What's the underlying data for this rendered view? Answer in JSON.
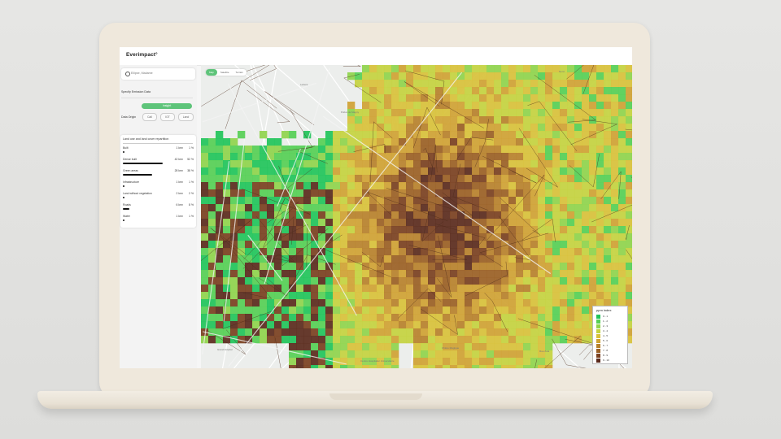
{
  "app": {
    "logo": "Everimpact°"
  },
  "search": {
    "placeholder": "Ellipse, Madame"
  },
  "emission": {
    "title": "Specify Emission Data",
    "insight_label": "Insight"
  },
  "origin": {
    "label": "Data Origin",
    "options": [
      "Call",
      "IOT",
      "Land"
    ]
  },
  "land": {
    "title": "Land use and land cover repartition",
    "rows": [
      {
        "name": "Built",
        "area": "1 km²",
        "pct": "1 %",
        "value": 0.01
      },
      {
        "name": "Dense built",
        "area": "42 km²",
        "pct": "52 %",
        "value": 0.52
      },
      {
        "name": "Green areas",
        "area": "28 km²",
        "pct": "38 %",
        "value": 0.38
      },
      {
        "name": "Infrastructure",
        "area": "1 km²",
        "pct": "1 %",
        "value": 0.01
      },
      {
        "name": "Land without vegetation",
        "area": "2 km²",
        "pct": "2 %",
        "value": 0.02
      },
      {
        "name": "Roads",
        "area": "6 km²",
        "pct": "8 %",
        "value": 0.08
      },
      {
        "name": "Water",
        "area": "1 km²",
        "pct": "1 %",
        "value": 0.01
      }
    ]
  },
  "map": {
    "tabs": [
      "Map",
      "Satellite",
      "Terrain"
    ],
    "labels": [
      "Lettera",
      "Pollux de Magny",
      "Grand Hôpital",
      "Chêne Magique",
      "Centre Hospitalier Universitaire",
      "Rue Zola",
      "Nord"
    ]
  },
  "legend": {
    "title": "ppm index",
    "items": [
      {
        "label": "0 - 1",
        "color": "#21c45a"
      },
      {
        "label": "1 - 2",
        "color": "#56cf55"
      },
      {
        "label": "2 - 3",
        "color": "#8fd44c"
      },
      {
        "label": "3 - 4",
        "color": "#c4d33f"
      },
      {
        "label": "4 - 5",
        "color": "#d8c13a"
      },
      {
        "label": "5 - 6",
        "color": "#cfa233"
      },
      {
        "label": "6 - 7",
        "color": "#b7812b"
      },
      {
        "label": "7 - 8",
        "color": "#9a5f24"
      },
      {
        "label": "8 - 9",
        "color": "#7a401f"
      },
      {
        "label": "9 - 10",
        "color": "#5a2a1c"
      }
    ]
  },
  "colors": {
    "accent": "#5ec47a",
    "lid": "#efe8dc"
  }
}
